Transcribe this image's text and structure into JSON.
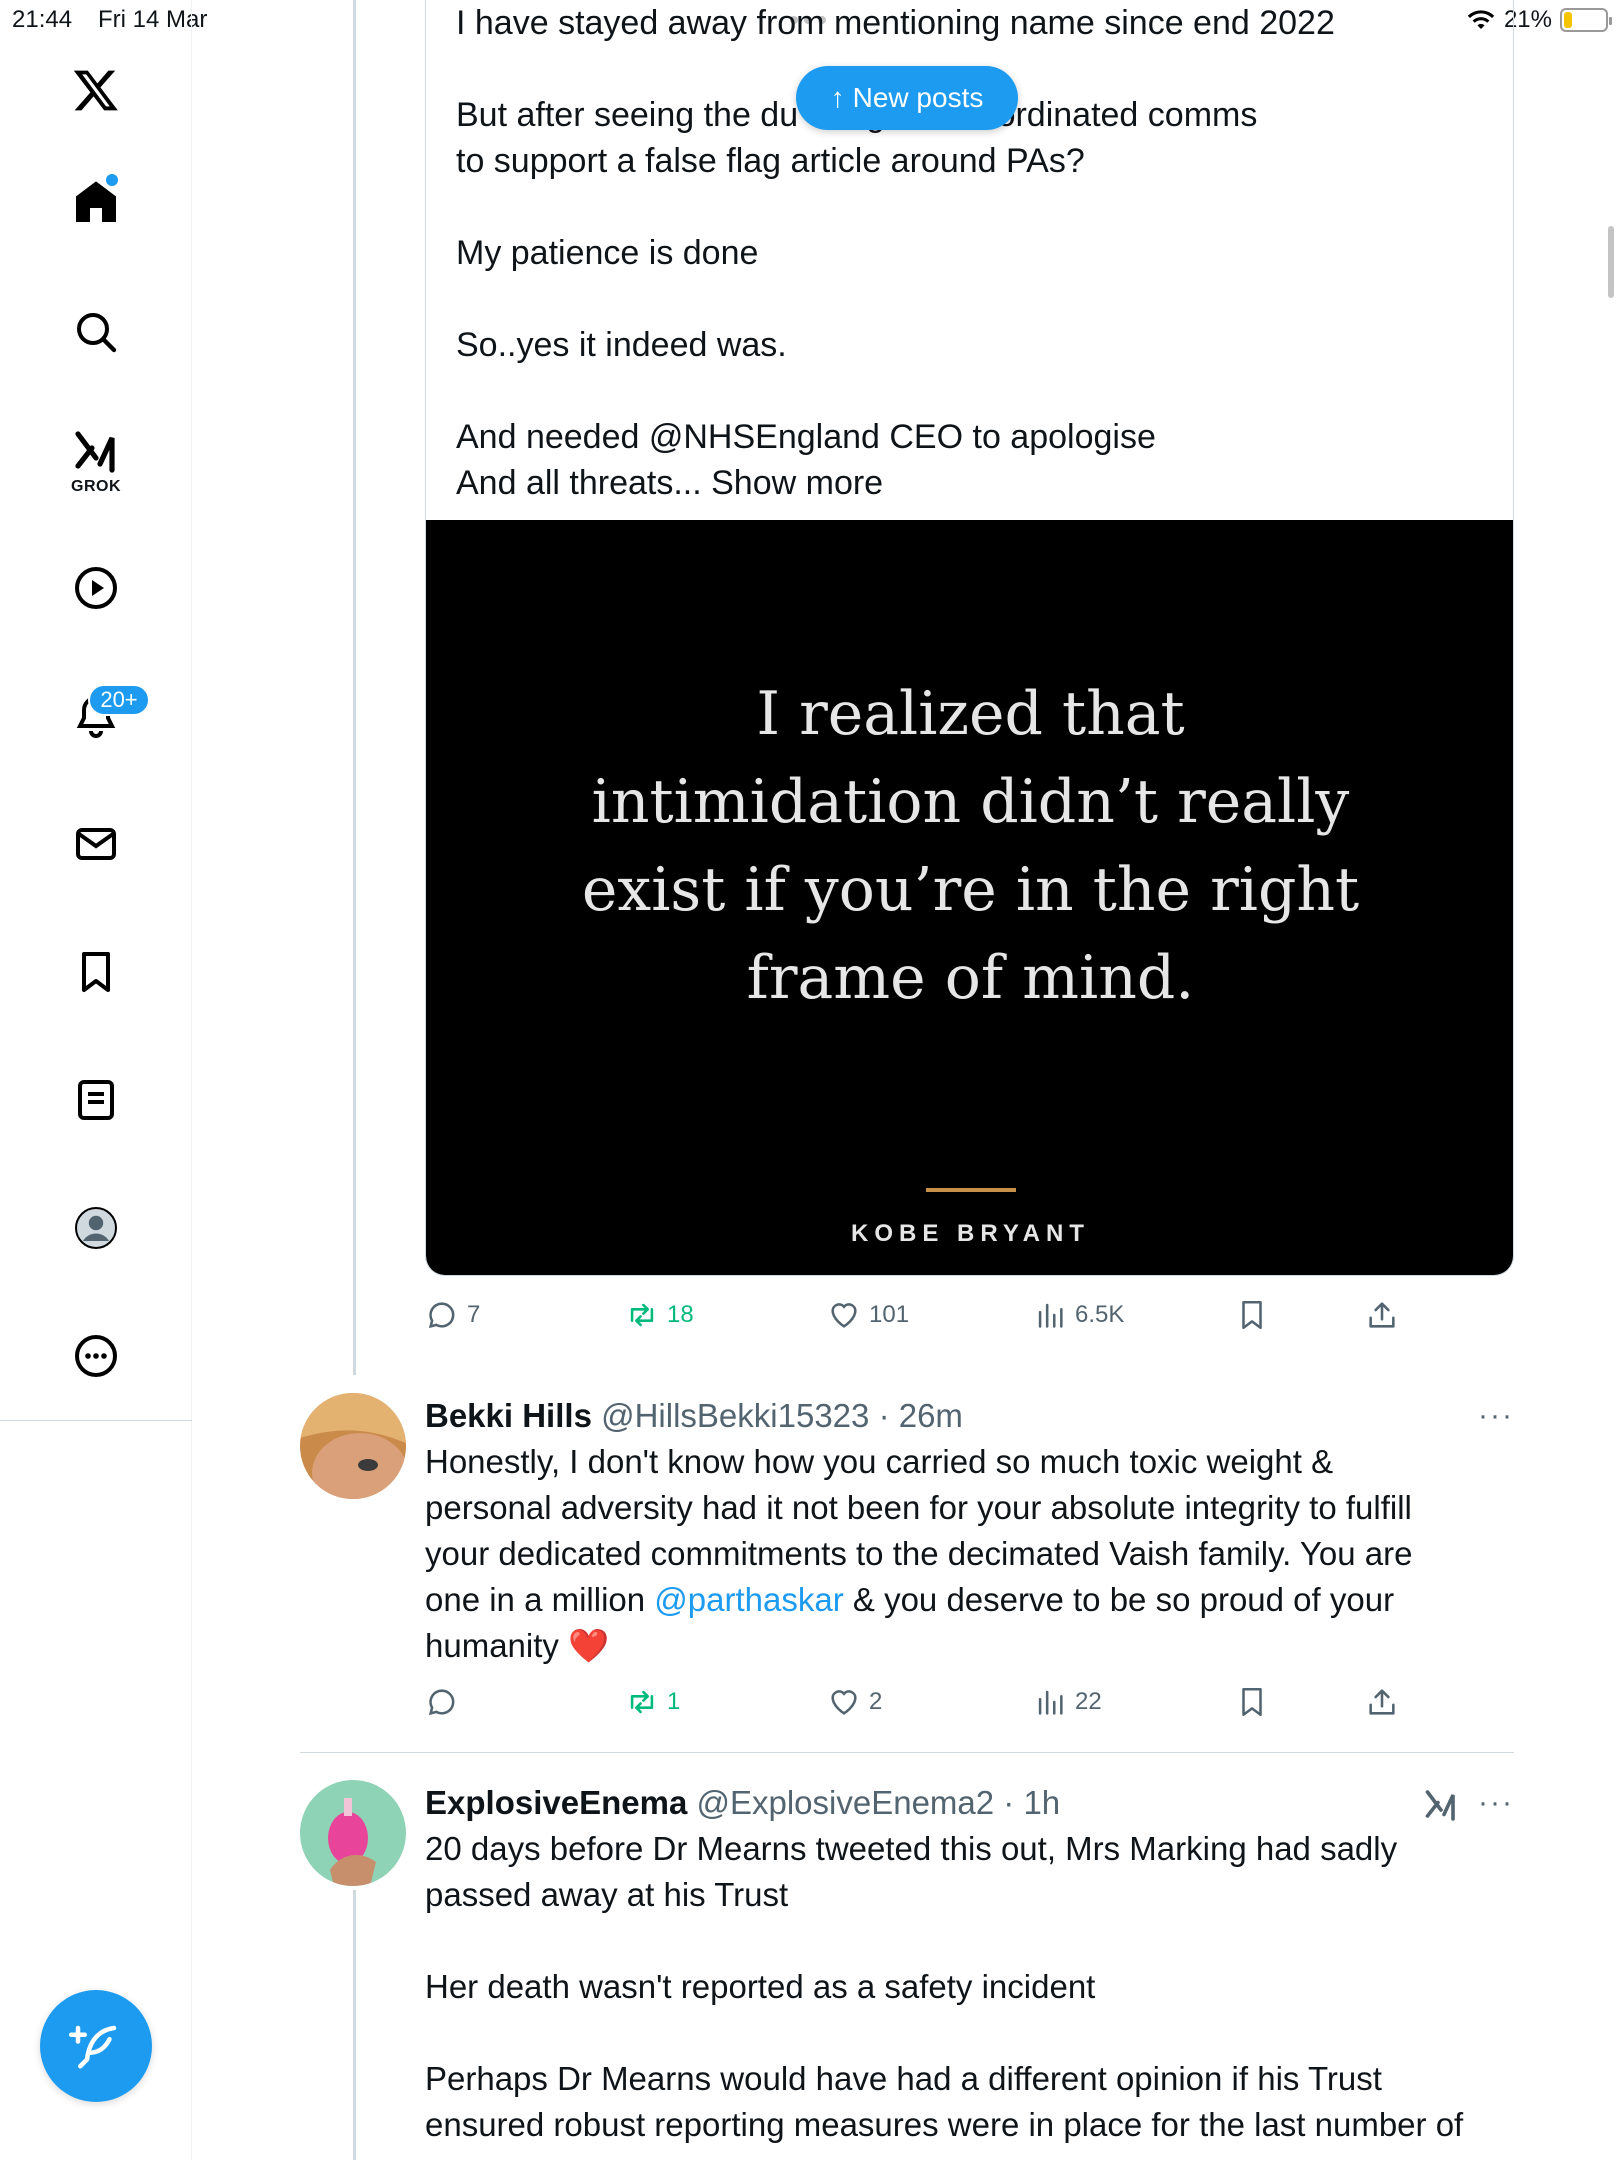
{
  "status_bar": {
    "time": "21:44",
    "date": "Fri 14 Mar",
    "battery": "21%",
    "battery_level": 0.21
  },
  "sidebar": {
    "grok_label": "GROK",
    "notifications_badge": "20+",
    "items": [
      "x-logo",
      "home-icon",
      "search-icon",
      "grok-icon",
      "video-icon",
      "notifications-icon",
      "messages-icon",
      "bookmarks-icon",
      "lists-icon",
      "profile-icon",
      "more-icon"
    ]
  },
  "new_posts_label": "New posts",
  "quote_tweet": {
    "text": "I have stayed away from mentioning name since end 2022\n\nBut after seeing the du                              d regards coordinated comms\nto support a false flag article around PAs?\n\nMy patience is done\n\nSo..yes it indeed was.\n\nAnd needed @NHSEngland CEO to apologise\nAnd all threats... Show more",
    "image_quote": "I realized that\nintimidation didn’t really\nexist if you’re in the right\nframe of mind.",
    "image_author": "KOBE BRYANT"
  },
  "main_actions": {
    "replies": "7",
    "reposts": "18",
    "likes": "101",
    "views": "6.5K"
  },
  "replies": [
    {
      "name": "Bekki Hills",
      "handle": "@HillsBekki15323",
      "time": "· 26m",
      "body_before": "Honestly, I don't know how you carried so much toxic weight &\npersonal adversity had it not been for your absolute integrity to fulfill\nyour dedicated commitments to the decimated Vaish family. You are\none in a million ",
      "mention": "@parthaskar",
      "body_after": " & you deserve to be so proud of your\nhumanity ",
      "emoji": "❤️",
      "actions": {
        "replies": "",
        "reposts": "1",
        "likes": "2",
        "views": "22"
      }
    },
    {
      "name": "ExplosiveEnema",
      "handle": "@ExplosiveEnema2",
      "time": "· 1h",
      "body": "20 days before Dr Mearns tweeted this out, Mrs Marking had sadly\npassed away at his Trust\n\nHer death wasn't reported as a safety incident\n\nPerhaps Dr Mearns would have had a different opinion if his Trust\nensured robust reporting measures were in place for the last number of"
    }
  ],
  "more_label": "···",
  "colors": {
    "accent": "#1d9bf0",
    "repost": "#00ba7c",
    "text": "#0f1419",
    "muted": "#536471"
  }
}
